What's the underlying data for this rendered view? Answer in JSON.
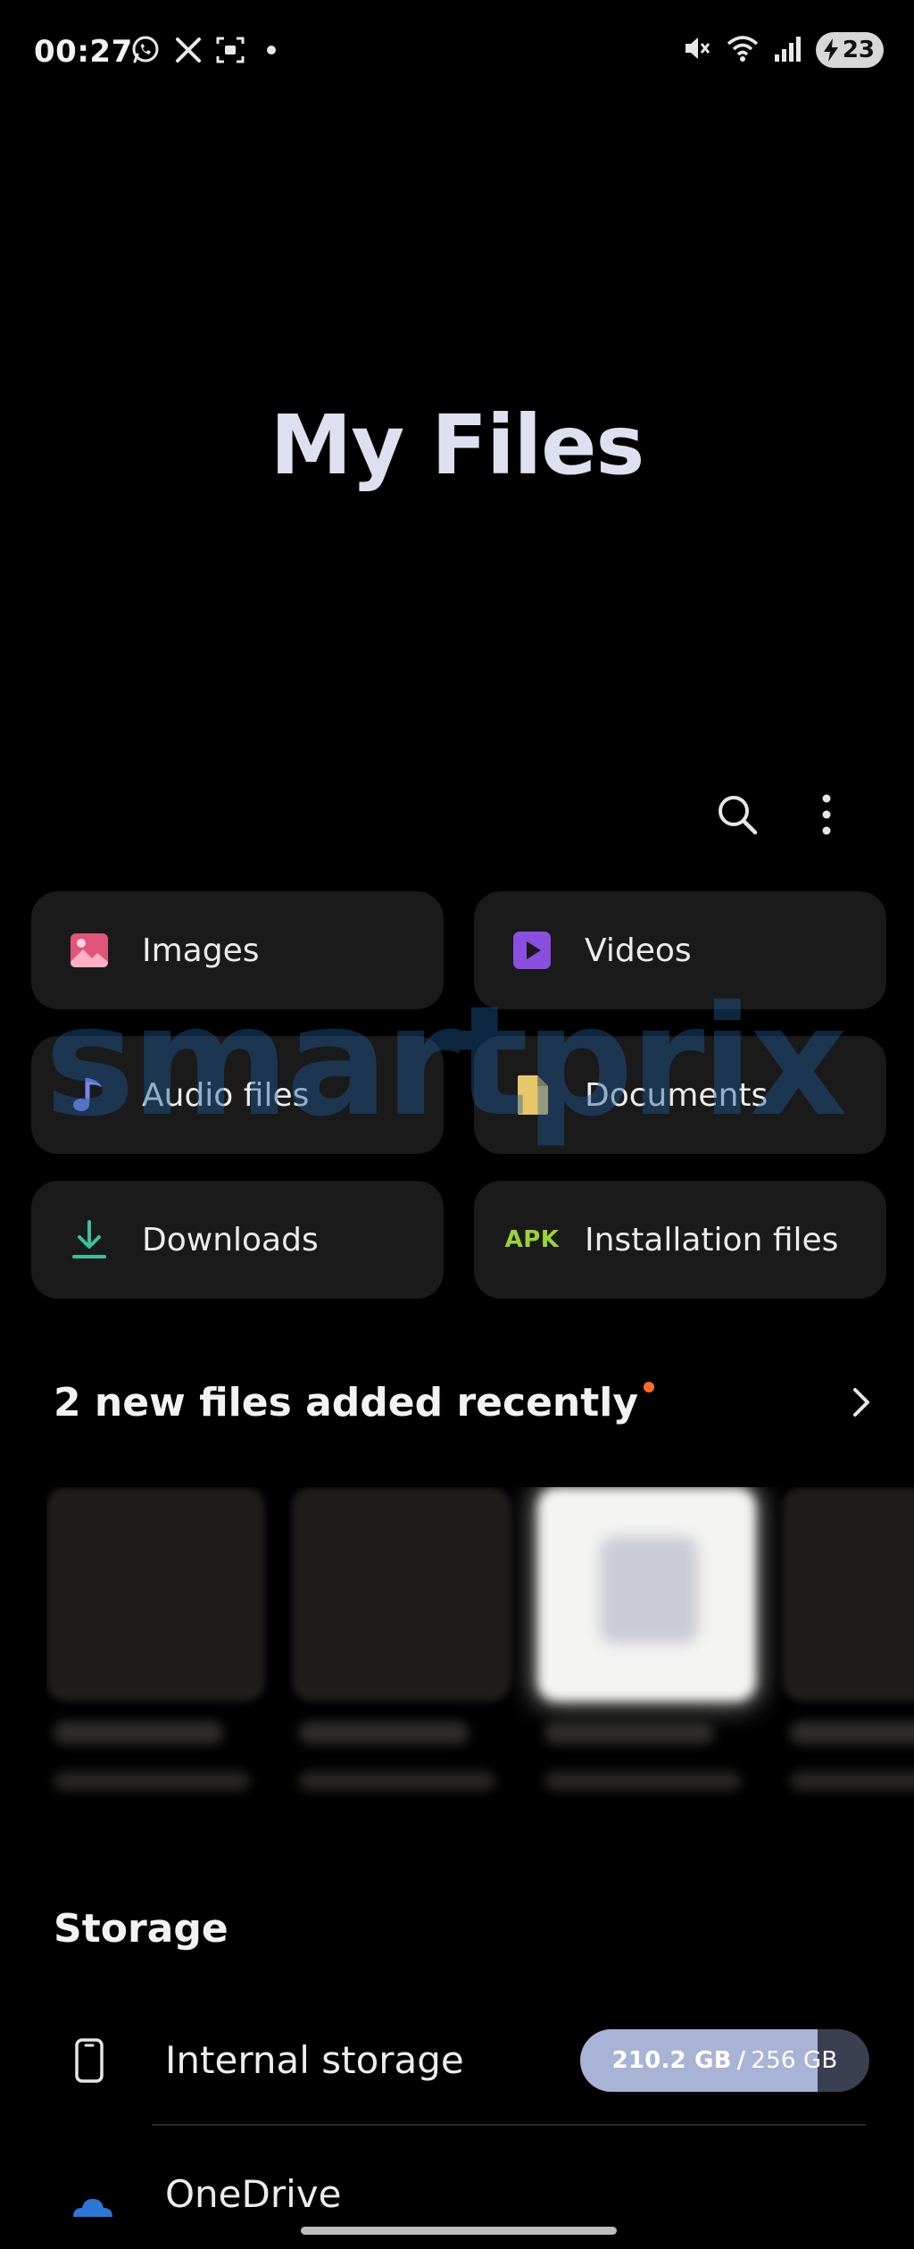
{
  "status_bar": {
    "time": "00:27",
    "left_icons": [
      "whatsapp-icon",
      "x-icon",
      "screenshot-icon",
      "notification-dot-icon"
    ],
    "right_icons": [
      "mute-icon",
      "wifi-icon",
      "signal-icon",
      "battery-icon"
    ],
    "battery": "23"
  },
  "header": {
    "title": "My Files"
  },
  "toolbar": {
    "icons": [
      "search-icon",
      "more-options-icon"
    ]
  },
  "categories": [
    {
      "label": "Images",
      "icon": "image-icon",
      "color": "#e0557a"
    },
    {
      "label": "Videos",
      "icon": "video-icon",
      "color": "#8a4fe0"
    },
    {
      "label": "Audio files",
      "icon": "music-note-icon",
      "color": "#7b86e8"
    },
    {
      "label": "Documents",
      "icon": "document-icon",
      "color": "#e8c66a"
    },
    {
      "label": "Downloads",
      "icon": "download-icon",
      "color": "#3bbf9a"
    },
    {
      "label": "Installation files",
      "icon": "APK",
      "color": "#9ad23a"
    }
  ],
  "watermark": "smartprix",
  "recent": {
    "title": "2 new files added recently",
    "new_indicator_color": "#ff6b2c"
  },
  "storage": {
    "title": "Storage",
    "items": [
      {
        "label": "Internal storage",
        "icon": "phone-icon",
        "used": "210.2 GB",
        "separator": "/",
        "total": "256 GB",
        "used_fraction": 0.82
      },
      {
        "label": "OneDrive",
        "icon": "onedrive-icon"
      }
    ]
  },
  "colors": {
    "background": "#000000",
    "tile": "#1a1a1a",
    "usage_fill": "#a9b3d6",
    "usage_track": "#3a3f52"
  }
}
